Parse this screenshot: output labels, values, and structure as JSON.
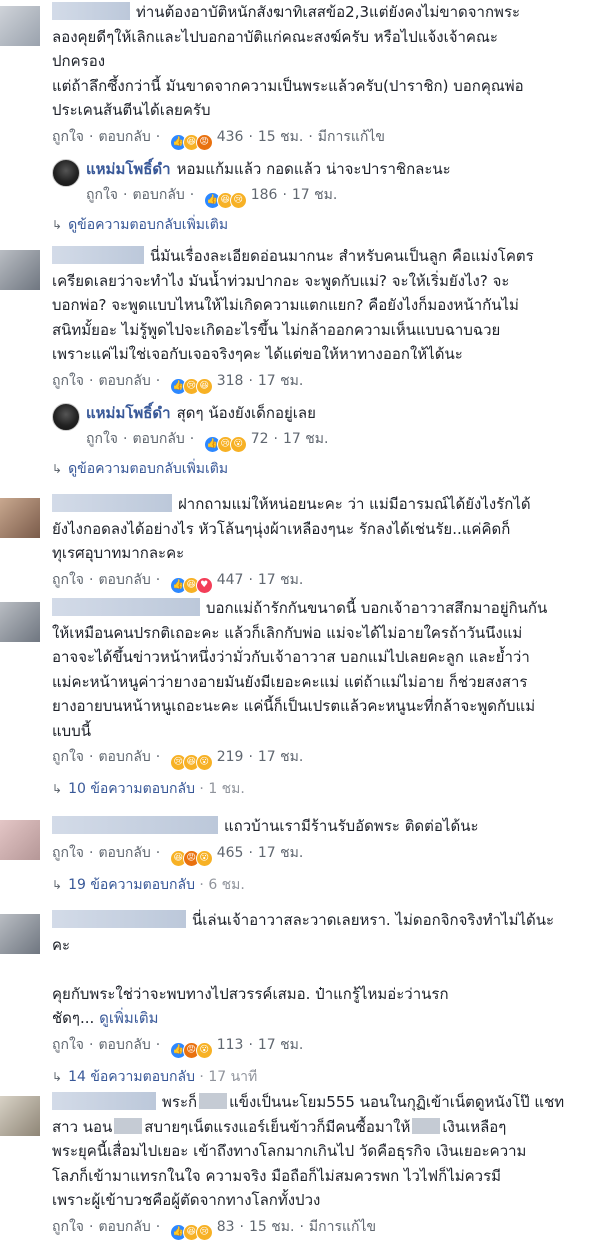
{
  "comments": [
    {
      "text_lines": [
        "ท่านต้องอาบัติหนักสังฆาทิเสสข้อ2,3แต่ยังคงไม่ขาดจากพระ",
        "ลองคุยดีๆให้เลิกและไปบอกอาบัติแก่คณะสงฆ์ครับ หรือไปแจ้งเจ้าคณะ",
        "ปกครอง",
        "แต่ถ้าลึกซึ้งกว่านี้ มันขาดจากความเป็นพระแล้วครับ(ปาราชิก) บอกคุณพ่อ",
        "ประเคนส้นตีนได้เลยครับ"
      ],
      "like": "ถูกใจ",
      "reply": "ตอบกลับ",
      "reactions": [
        "like",
        "haha",
        "angry"
      ],
      "count": "436",
      "time": "15 ชม.",
      "edited": "มีการแก้ไข",
      "sub": {
        "name": "แหม่มโพธิ์ดำ",
        "text": "หอมแก้มแล้ว กอดแล้ว น่าจะปาราชิกละนะ",
        "like": "ถูกใจ",
        "reply": "ตอบกลับ",
        "reactions": [
          "like",
          "haha",
          "sad"
        ],
        "count": "186",
        "time": "17 ชม."
      },
      "more": "ดูข้อความตอบกลับเพิ่มเติม"
    },
    {
      "text_lines": [
        "นี่มันเรื่องละเอียดอ่อนมากนะ สำหรับคนเป็นลูก คือแม่งโคตร",
        "เครียดเลยว่าจะทำไง มันน้ำท่วมปากอะ จะพูดกับแม่? จะให้เริ่มยังไง? จะ",
        "บอกพ่อ? จะพูดแบบไหนให้ไม่เกิดความแตกแยก? คือยังไงก็มองหน้ากันไม่",
        "สนิทมั้ยอะ ไม่รู้พูดไปจะเกิดอะไรขึ้น ไม่กล้าออกความเห็นแบบฉาบฉวย",
        "เพราะแค่ไม่ใช่เจอกับเจอจริงๆคะ ได้แต่ขอให้หาทางออกให้ได้นะ"
      ],
      "like": "ถูกใจ",
      "reply": "ตอบกลับ",
      "reactions": [
        "like",
        "sad",
        "haha"
      ],
      "count": "318",
      "time": "17 ชม.",
      "sub": {
        "name": "แหม่มโพธิ์ดำ",
        "text": "สุดๆ น้องยังเด็กอยู่เลย",
        "like": "ถูกใจ",
        "reply": "ตอบกลับ",
        "reactions": [
          "like",
          "sad",
          "wow"
        ],
        "count": "72",
        "time": "17 ชม."
      },
      "more": "ดูข้อความตอบกลับเพิ่มเติม"
    },
    {
      "text_lines": [
        "ฝากถามแม่ให้หน่อยนะคะ ว่า แม่มีอารมณ์ได้ยังไงรักได้",
        "ยังไงกอดลงได้อย่างไร หัวโล้นๆนุ่งผ้าเหลืองๆนะ รักลงได้เช่นรัย..แค่คิดก็",
        "ทุเรศอุบาทมากละคะ"
      ],
      "like": "ถูกใจ",
      "reply": "ตอบกลับ",
      "reactions": [
        "like",
        "haha",
        "love"
      ],
      "count": "447",
      "time": "17 ชม."
    },
    {
      "text_lines": [
        "บอกแม่ถ้ารักกันขนาดนี้ บอกเจ้าอาวาสสึกมาอยู่กินกัน",
        "ให้เหมือนคนปรกติเถอะคะ แล้วก็เลิกกับพ่อ แม่จะได้ไม่อายใครถ้าวันนึงแม่",
        "อาจจะได้ขึ้นข่าวหน้าหนึ่งว่ามั่วกับเจ้าอาวาส บอกแม่ไปเลยคะลูก และย้ำว่า",
        "แม่คะหน้าหนูค่าว่ายางอายมันยังมีเยอะคะแม่ แต่ถ้าแม่ไม่อาย ก็ช่วยสงสาร",
        "ยางอายบนหน้าหนูเถอะนะคะ แค่นี้ก็เป็นเปรตแล้วคะหนูนะที่กล้าจะพูดกับแม่",
        "แบบนี้"
      ],
      "like": "ถูกใจ",
      "reply": "ตอบกลับ",
      "reactions": [
        "sad",
        "haha",
        "wow"
      ],
      "count": "219",
      "time": "17 ชม.",
      "more_count": "10 ข้อความตอบกลับ",
      "more_time": "1 ชม."
    },
    {
      "text_lines": [
        "แถวบ้านเรามีร้านรับอัดพระ ติดต่อได้นะ"
      ],
      "like": "ถูกใจ",
      "reply": "ตอบกลับ",
      "reactions": [
        "haha",
        "angry",
        "wow"
      ],
      "count": "465",
      "time": "17 ชม.",
      "more_count": "19 ข้อความตอบกลับ",
      "more_time": "6 ชม."
    },
    {
      "text_lines": [
        "นี่เล่นเจ้าอาวาสละวาดเลยหรา. ไม่ดอกจิกจริงทำไม่ได้นะ",
        "คะ",
        "",
        "คุยกับพระใช่ว่าจะพบทางไปสวรรค์เสมอ. ป๋าแกรู้ไหมอ่ะว่านรก"
      ],
      "last_line": "ชัดๆ...",
      "see_more": "ดูเพิ่มเติม",
      "like": "ถูกใจ",
      "reply": "ตอบกลับ",
      "reactions": [
        "like",
        "angry",
        "wow"
      ],
      "count": "113",
      "time": "17 ชม.",
      "more_count": "14 ข้อความตอบกลับ",
      "more_time": "17 นาที"
    },
    {
      "line1_a": "พระก็",
      "line1_b": "แข็งเป็นนะโยม555 นอนในกุฏิเข้าเน็ตดูหนังโป๊ แชท",
      "line2_a": "สาว นอน",
      "line2_b": "สบายๆเน็ตแรงแอร์เย็นข้าวก็มีคนซื้อมาให้",
      "line2_c": "เงินเหลือๆ",
      "text_lines": [
        "พระยุคนี้เสื่อมไปเยอะ เข้าถึงทางโลกมากเกินไป วัดคือธุรกิจ เงินเยอะความ",
        "โลภก็เข้ามาแทรกในใจ ความจริง มือถือก็ไม่สมควรพก ไวไฟก็ไม่ควรมี",
        "เพราะผู้เข้าบวชคือผู้ตัดจากทางโลกทั้งปวง"
      ],
      "like": "ถูกใจ",
      "reply": "ตอบกลับ",
      "reactions": [
        "like",
        "haha",
        "sad"
      ],
      "count": "83",
      "time": "15 ชม.",
      "edited": "มีการแก้ไข"
    }
  ]
}
